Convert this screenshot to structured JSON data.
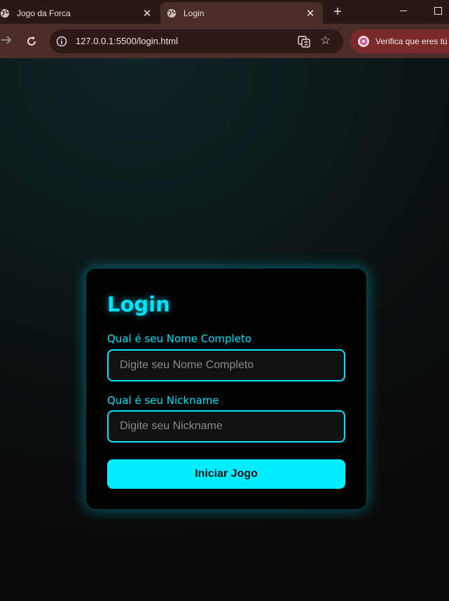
{
  "browser": {
    "tabs": [
      {
        "title": "Jogo da Forca",
        "active": false
      },
      {
        "title": "Login",
        "active": true
      }
    ],
    "new_tab_label": "+",
    "address": "127.0.0.1:5500/login.html",
    "profile_text": "Verifica que eres tú",
    "colors": {
      "tabstrip": "#2b1714",
      "toolbar": "#4a2d29",
      "profile": "#7a2a2a"
    }
  },
  "login": {
    "title": "Login",
    "name_label": "Qual é seu Nome Completo",
    "name_placeholder": "Digite seu Nome Completo",
    "nick_label": "Qual é seu Nickname",
    "nick_placeholder": "Digite seu Nickname",
    "submit_label": "Iniciar Jogo",
    "colors": {
      "accent": "#00e5ff",
      "card": "#010101",
      "input_bg": "#111111"
    }
  }
}
